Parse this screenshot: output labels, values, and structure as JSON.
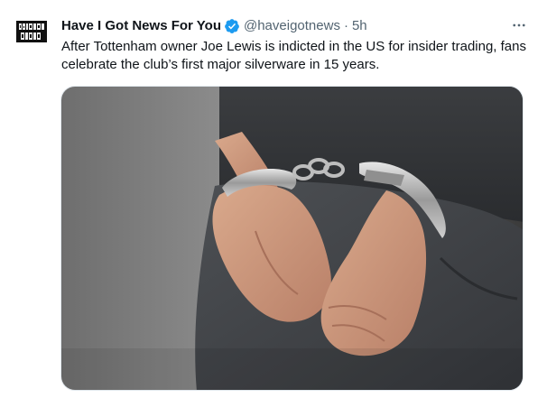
{
  "tweet": {
    "author_name": "Have I Got News For You",
    "handle": "@haveigotnews",
    "separator": "·",
    "time": "5h",
    "text": "After Tottenham owner Joe Lewis is indicted in the US for insider trading, fans celebrate the club’s first major silverware in 15 years.",
    "verified": true,
    "verified_color": "#1d9bf0",
    "more_icon": "more-horizontal-icon",
    "media_alt": "Photo of hands in handcuffs behind a person's back",
    "avatar_logo_text": "HAVE I GOT NEWS FOR YOU"
  }
}
